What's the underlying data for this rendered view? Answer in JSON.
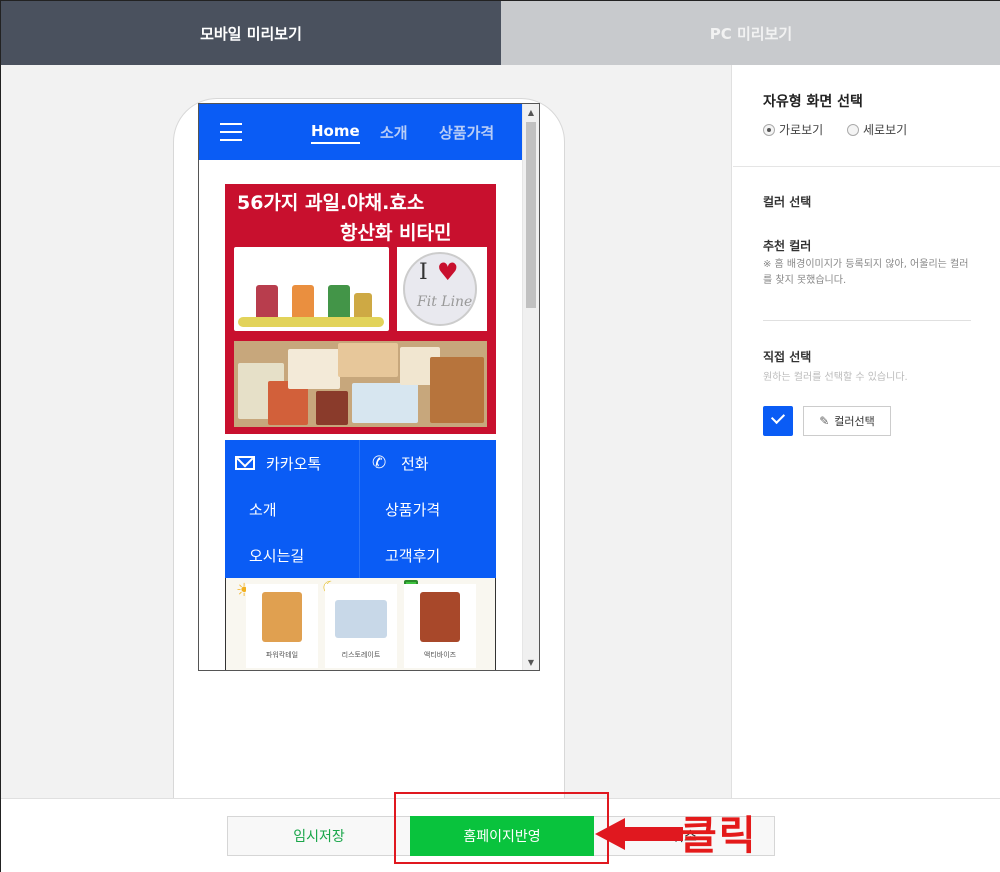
{
  "tabs": {
    "mobile": "모바일 미리보기",
    "pc": "PC 미리보기"
  },
  "site": {
    "nav": {
      "home": "Home",
      "about": "소개",
      "price": "상품가격"
    },
    "banner": {
      "line1": "56가지 과일.야채.효소",
      "line2": "항산화 비타민"
    },
    "menu": {
      "kakao": "카카오톡",
      "call": "전화",
      "about": "소개",
      "price": "상품가격",
      "directions": "오시는길",
      "reviews": "고객후기"
    },
    "products": [
      {
        "name": "파워칵테일"
      },
      {
        "name": "리스토레이트"
      },
      {
        "name": "액티바이즈"
      }
    ]
  },
  "side": {
    "screen_title": "자유형 화면 선택",
    "radio_landscape": "가로보기",
    "radio_portrait": "세로보기",
    "color_title": "컬러 선택",
    "recommend_title": "추천 컬러",
    "recommend_note": "※ 홈 배경이미지가 등록되지 않아, 어울리는 컬러를 찾지 못했습니다.",
    "direct_title": "직접 선택",
    "direct_note": "원하는 컬러를 선택할 수 있습니다.",
    "color_button": "컬러선택"
  },
  "bottom": {
    "save": "임시저장",
    "apply": "홈페이지반영",
    "cancel": "취소"
  },
  "annotation": {
    "label": "클릭"
  },
  "colors": {
    "brand_blue": "#0a5cf5",
    "apply_green": "#09c33d",
    "annotation_red": "#e0181f"
  }
}
